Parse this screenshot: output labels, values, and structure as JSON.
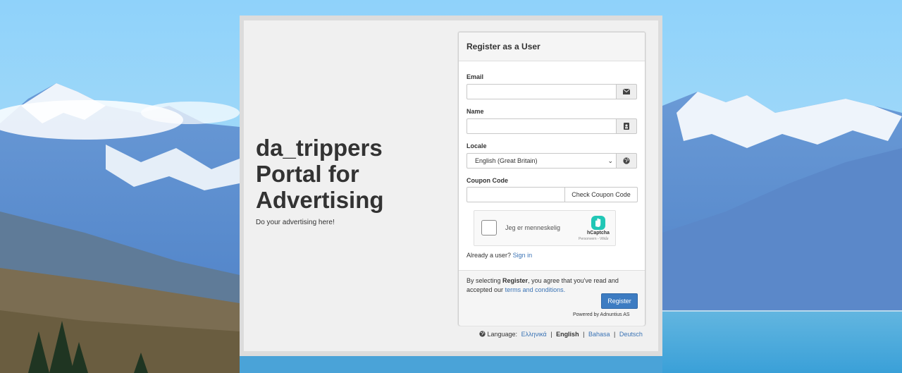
{
  "brand": {
    "title_line1": "da_trippers",
    "title_line2": "Portal for",
    "title_line3": "Advertising",
    "subtitle": "Do your advertising here!"
  },
  "card": {
    "title": "Register as a User",
    "email_label": "Email",
    "email_icon": "envelope-icon",
    "name_label": "Name",
    "name_icon": "contact-card-icon",
    "locale_label": "Locale",
    "locale_value": "English (Great Britain)",
    "locale_icon": "globe-icon",
    "coupon_label": "Coupon Code",
    "coupon_button": "Check Coupon Code",
    "captcha_text": "Jeg er menneskelig",
    "captcha_brand": "hCaptcha",
    "captcha_links": "Personvern - Vilkår",
    "already_text": "Already a user?",
    "sign_in": "Sign in",
    "agree_prefix": "By selecting",
    "agree_bold": "Register",
    "agree_middle": ", you agree that you've read and accepted our",
    "agree_link": "terms and conditions.",
    "register_button": "Register",
    "powered_by": "Powered by Adnuntius AS"
  },
  "language": {
    "label": "Language:",
    "options": [
      "Ελληνικά",
      "English",
      "Bahasa",
      "Deutsch"
    ],
    "current": "English"
  },
  "colors": {
    "accent": "#3d7cc2",
    "link": "#3a73b5",
    "panel": "#f0f0f0"
  }
}
